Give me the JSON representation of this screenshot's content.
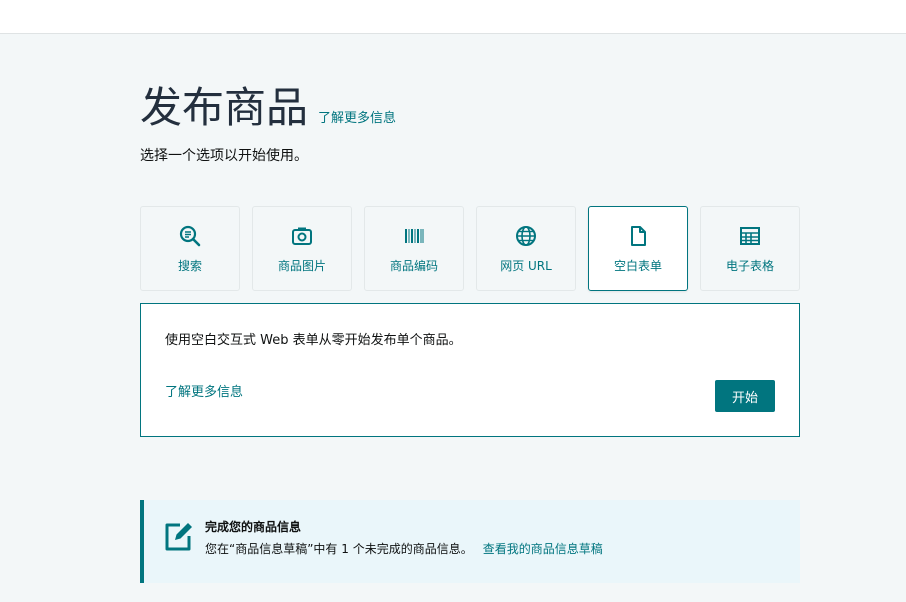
{
  "header": {
    "title": "发布商品",
    "learn_more": "了解更多信息",
    "subtitle": "选择一个选项以开始使用。"
  },
  "options": [
    {
      "label": "搜索",
      "icon": "search-document-icon"
    },
    {
      "label": "商品图片",
      "icon": "camera-icon"
    },
    {
      "label": "商品编码",
      "icon": "barcode-icon"
    },
    {
      "label": "网页 URL",
      "icon": "globe-icon"
    },
    {
      "label": "空白表单",
      "icon": "blank-document-icon",
      "selected": true
    },
    {
      "label": "电子表格",
      "icon": "spreadsheet-icon"
    }
  ],
  "panel": {
    "description": "使用空白交互式 Web 表单从零开始发布单个商品。",
    "learn_more": "了解更多信息",
    "start_label": "开始"
  },
  "draft": {
    "title": "完成您的商品信息",
    "text": "您在“商品信息草稿”中有 1 个未完成的商品信息。",
    "link": "查看我的商品信息草稿",
    "icon": "edit-icon"
  },
  "colors": {
    "accent": "#01757f",
    "page_bg": "#f3f7f8",
    "draft_bg": "#eaf6fa"
  }
}
